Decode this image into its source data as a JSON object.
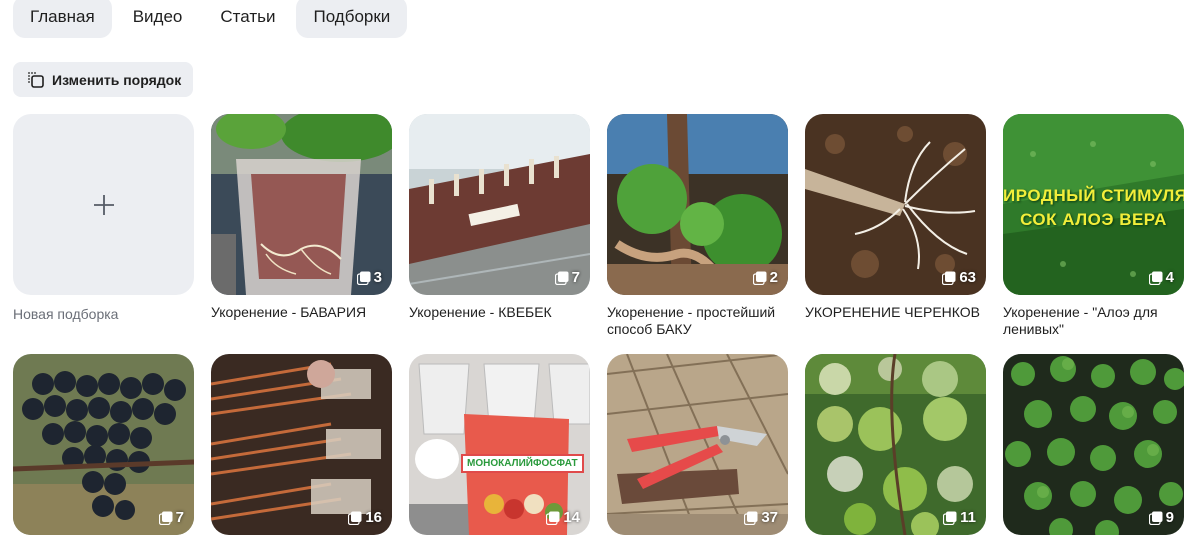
{
  "tabs": [
    {
      "label": "Главная",
      "active": true
    },
    {
      "label": "Видео",
      "active": false
    },
    {
      "label": "Статьи",
      "active": false
    },
    {
      "label": "Подборки",
      "active": true
    }
  ],
  "toolbar": {
    "reorder_label": "Изменить порядок",
    "reorder_icon": "reorder-icon"
  },
  "new_collection": {
    "label": "Новая подборка",
    "icon": "plus-icon"
  },
  "collections": [
    {
      "title": "Укоренение - БАВАРИЯ",
      "count": "3"
    },
    {
      "title": "Укоренение - КВЕБЕК",
      "count": "7"
    },
    {
      "title": "Укоренение - простейший способ БАКУ",
      "count": "2"
    },
    {
      "title": "УКОРЕНЕНИЕ ЧЕРЕНКОВ",
      "count": "63"
    },
    {
      "title": "Укоренение - \"Алоэ для ленивых\"",
      "count": "4",
      "overlay_line1": "ИРОДНЫЙ СТИМУЛЯ",
      "overlay_line2": "СОК АЛОЭ ВЕРА"
    },
    {
      "title": "",
      "count": "7"
    },
    {
      "title": "",
      "count": "16"
    },
    {
      "title": "",
      "count": "14",
      "product_label": "МОНОКАЛИЙФОСФАТ"
    },
    {
      "title": "",
      "count": "37"
    },
    {
      "title": "",
      "count": "11"
    },
    {
      "title": "",
      "count": "9"
    }
  ],
  "colors": {
    "tab_active_bg": "#eceef2",
    "badge_text": "#ffffff",
    "caption_muted": "#6b6f78"
  }
}
